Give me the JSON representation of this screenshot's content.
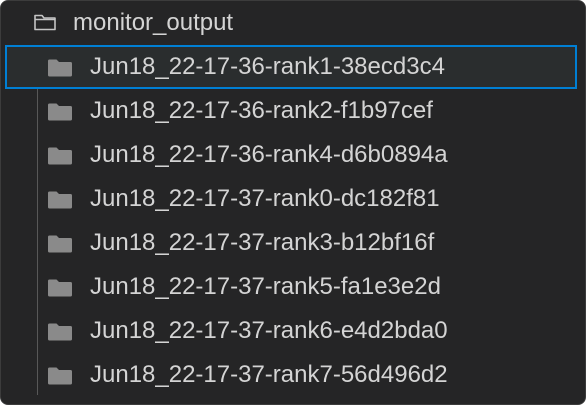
{
  "explorer": {
    "root_folder": {
      "label": "monitor_output",
      "icon": "folder-outline-icon"
    },
    "items": [
      {
        "label": "Jun18_22-17-36-rank1-38ecd3c4",
        "icon": "folder-icon",
        "selected": true
      },
      {
        "label": "Jun18_22-17-36-rank2-f1b97cef",
        "icon": "folder-icon",
        "selected": false
      },
      {
        "label": "Jun18_22-17-36-rank4-d6b0894a",
        "icon": "folder-icon",
        "selected": false
      },
      {
        "label": "Jun18_22-17-37-rank0-dc182f81",
        "icon": "folder-icon",
        "selected": false
      },
      {
        "label": "Jun18_22-17-37-rank3-b12bf16f",
        "icon": "folder-icon",
        "selected": false
      },
      {
        "label": "Jun18_22-17-37-rank5-fa1e3e2d",
        "icon": "folder-icon",
        "selected": false
      },
      {
        "label": "Jun18_22-17-37-rank6-e4d2bda0",
        "icon": "folder-icon",
        "selected": false
      },
      {
        "label": "Jun18_22-17-37-rank7-56d496d2",
        "icon": "folder-icon",
        "selected": false
      }
    ]
  },
  "colors": {
    "background": "#252526",
    "text": "#d4d4d4",
    "folder_icon": "#8a8a8a",
    "selection_border": "#007fd4",
    "indent_guide": "#585858"
  }
}
